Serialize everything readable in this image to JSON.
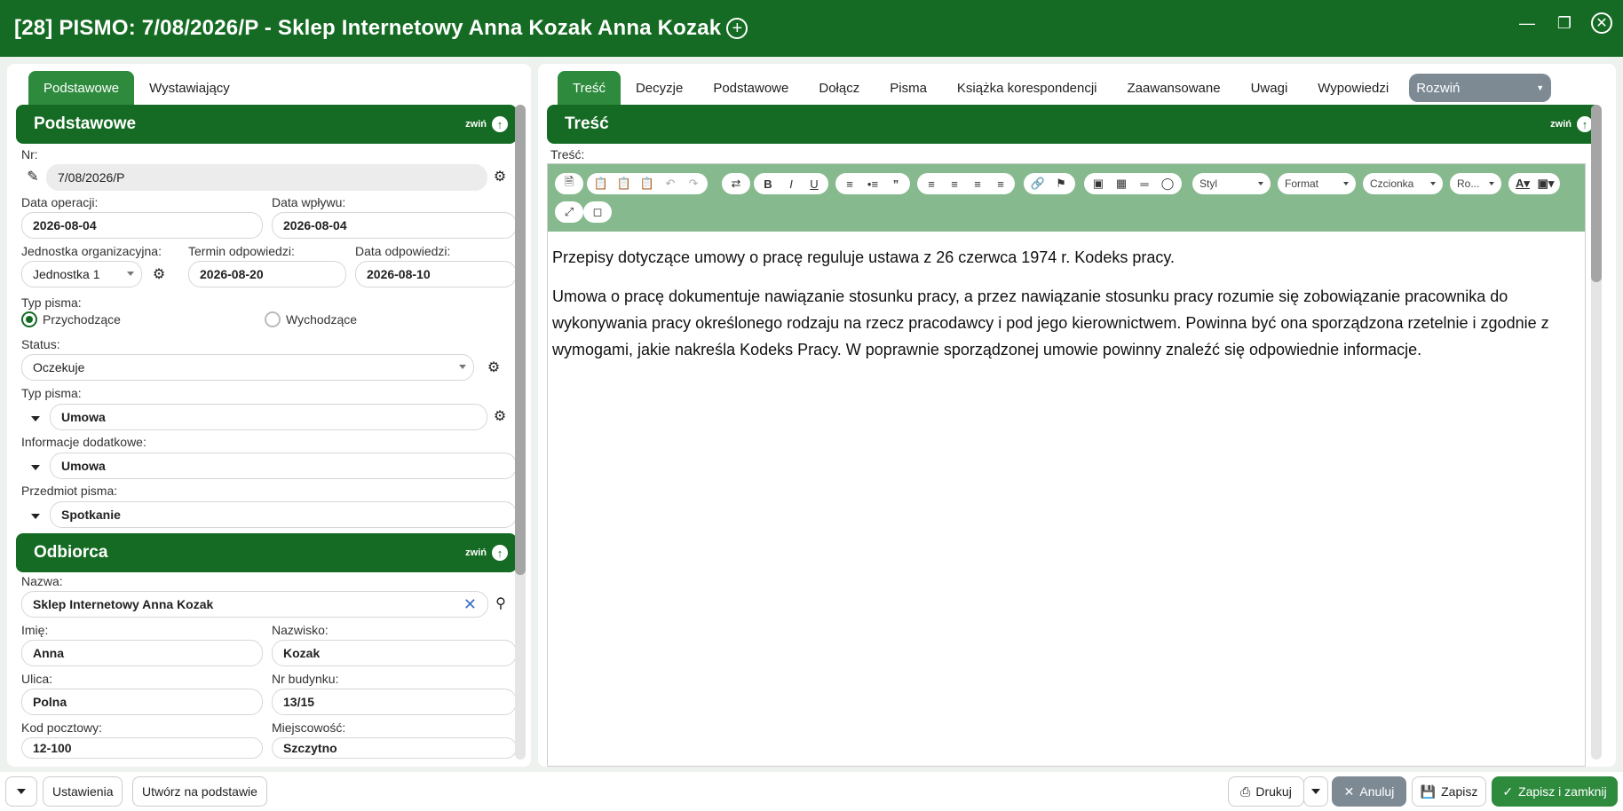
{
  "window": {
    "title": "[28] PISMO: 7/08/2026/P - Sklep Internetowy Anna Kozak Anna Kozak"
  },
  "left": {
    "tabs": [
      "Podstawowe",
      "Wystawiający"
    ],
    "section_basic": {
      "title": "Podstawowe",
      "collapse": "zwiń",
      "nr_label": "Nr:",
      "nr_value": "7/08/2026/P",
      "data_operacji_label": "Data operacji:",
      "data_operacji_value": "2026-08-04",
      "data_wplywu_label": "Data wpływu:",
      "data_wplywu_value": "2026-08-04",
      "jednostka_label": "Jednostka organizacyjna:",
      "jednostka_value": "Jednostka 1",
      "termin_label": "Termin odpowiedzi:",
      "termin_value": "2026-08-20",
      "data_odp_label": "Data odpowiedzi:",
      "data_odp_value": "2026-08-10",
      "typ_label": "Typ pisma:",
      "radio_in": "Przychodzące",
      "radio_out": "Wychodzące",
      "status_label": "Status:",
      "status_value": "Oczekuje",
      "typ2_label": "Typ pisma:",
      "typ2_value": "Umowa",
      "info_label": "Informacje dodatkowe:",
      "info_value": "Umowa",
      "przedmiot_label": "Przedmiot pisma:",
      "przedmiot_value": "Spotkanie"
    },
    "section_recipient": {
      "title": "Odbiorca",
      "collapse": "zwiń",
      "nazwa_label": "Nazwa:",
      "nazwa_value": "Sklep Internetowy Anna Kozak",
      "imie_label": "Imię:",
      "imie_value": "Anna",
      "nazwisko_label": "Nazwisko:",
      "nazwisko_value": "Kozak",
      "ulica_label": "Ulica:",
      "ulica_value": "Polna",
      "nr_bud_label": "Nr budynku:",
      "nr_bud_value": "13/15",
      "kod_label": "Kod pocztowy:",
      "kod_value": "12-100",
      "miejsc_label": "Miejscowość:",
      "miejsc_value": "Szczytno"
    }
  },
  "right": {
    "tabs": [
      "Treść",
      "Decyzje",
      "Podstawowe",
      "Dołącz",
      "Pisma",
      "Książka korespondencji",
      "Zaawansowane",
      "Uwagi",
      "Wypowiedzi"
    ],
    "expand_select": "Rozwiń",
    "section_title": "Treść",
    "collapse": "zwiń",
    "content_label": "Treść:",
    "toolbar_selects": [
      "Styl",
      "Format",
      "Czcionka",
      "Ro..."
    ],
    "paragraphs": [
      "Przepisy dotyczące umowy o pracę reguluje ustawa z 26 czerwca 1974 r. Kodeks pracy.",
      "Umowa o pracę dokumentuje nawiązanie stosunku pracy, a przez nawiązanie stosunku pracy rozumie się zobowiązanie pracownika do wykonywania pracy określonego rodzaju na rzecz pracodawcy i pod jego kierownictwem. Powinna być ona sporządzona rzetelnie i zgodnie z wymogami, jakie nakreśla Kodeks Pracy. W poprawnie sporządzonej umowie powinny znaleźć się odpowiednie informacje."
    ]
  },
  "footer": {
    "settings": "Ustawienia",
    "create_from": "Utwórz na podstawie",
    "print": "Drukuj",
    "cancel": "Anuluj",
    "save": "Zapisz",
    "save_close": "Zapisz i zamknij"
  },
  "colors": {
    "brand_green": "#156b23",
    "tab_green": "#2e8b3d",
    "toolbar_green": "#86ba8e"
  }
}
